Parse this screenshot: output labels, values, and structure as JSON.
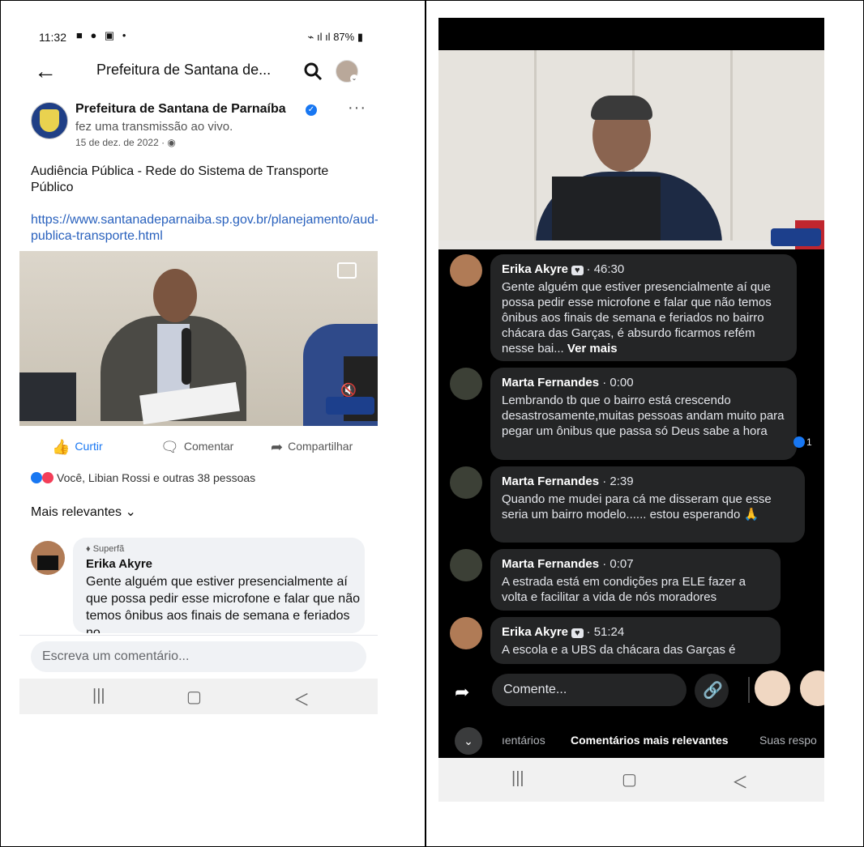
{
  "left": {
    "status": {
      "time": "11:32",
      "battery": "87%"
    },
    "header": {
      "title": "Prefeitura de Santana de..."
    },
    "post": {
      "page_name": "Prefeitura de Santana de Parnaíba",
      "action": "fez uma transmissão ao vivo.",
      "date": "15 de dez. de 2022 · ",
      "text": "Audiência Pública - Rede do Sistema de Transporte Público",
      "link": "https://www.santanadeparnaiba.sp.gov.br/planejamento/aud-publica-transporte.html"
    },
    "actions": {
      "like": "Curtir",
      "comment": "Comentar",
      "share": "Compartilhar"
    },
    "reactions_text": "Você, Libian Rossi e outras 38 pessoas",
    "sort_label": "Mais relevantes",
    "comment": {
      "badge": "Superfã",
      "name": "Erika Akyre",
      "text": "Gente alguém que estiver presencialmente aí que possa pedir esse microfone e falar que não temos ônibus aos finais de semana e feriados no"
    },
    "composer_placeholder": "Escreva um comentário..."
  },
  "right": {
    "comments": [
      {
        "name": "Erika Akyre",
        "time": "· 46:30",
        "text": "Gente alguém que estiver presencialmente aí que possa pedir esse microfone e falar que não temos ônibus aos finais de semana e feriados no bairro chácara das Garças, é absurdo ficarmos refém nesse bai...",
        "more": "Ver mais"
      },
      {
        "name": "Marta Fernandes",
        "time": "· 0:00",
        "text": "Lembrando tb que o bairro está crescendo desastrosamente,muitas pessoas andam muito para pegar um ônibus que passa só Deus sabe a hora",
        "likes": "1"
      },
      {
        "name": "Marta Fernandes",
        "time": "· 2:39",
        "text": "Quando me mudei para cá me disseram que esse seria um bairro modelo...... estou esperando 🙏"
      },
      {
        "name": "Marta Fernandes",
        "time": "· 0:07",
        "text": "A estrada está em condições pra ELE fazer a volta e facilitar a vida de nós moradores"
      },
      {
        "name": "Erika Akyre",
        "time": "· 51:24",
        "text": "A escola e a UBS da chácara das Garças é"
      }
    ],
    "composer_placeholder": "Comente...",
    "tabs": [
      "ıentários",
      "Comentários mais relevantes",
      "Suas respo"
    ]
  }
}
